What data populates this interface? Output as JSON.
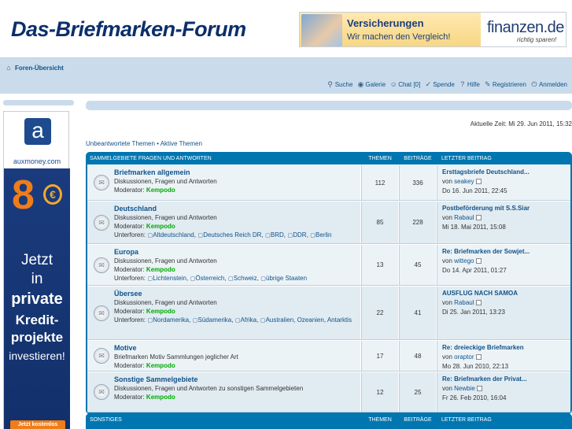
{
  "site": {
    "title": "Das-Briefmarken-Forum"
  },
  "banner": {
    "line1": "Versicherungen",
    "line2": "Wir machen den Vergleich!",
    "logo": "finanzen.de",
    "logo_sub": "richtig sparen!"
  },
  "nav": {
    "breadcrumb": "Foren-Übersicht",
    "links": [
      {
        "label": "Suche",
        "icon": "search-icon"
      },
      {
        "label": "Galerie",
        "icon": "eye-icon"
      },
      {
        "label": "Chat [0]",
        "icon": "users-icon"
      },
      {
        "label": "Spende",
        "icon": "check-icon"
      },
      {
        "label": "Hilfe",
        "icon": "question-icon"
      },
      {
        "label": "Registrieren",
        "icon": "pen-icon"
      },
      {
        "label": "Anmelden",
        "icon": "power-icon"
      }
    ]
  },
  "left_ad": {
    "brand": "auxmoney.com",
    "l1": "Jetzt",
    "l2": "in",
    "l3": "private",
    "l4": "Kredit-",
    "l5": "projekte",
    "l6": "investieren!",
    "button": "Jetzt kostenlos"
  },
  "main": {
    "current_time": "Aktuelle Zeit: Mi 29. Jun 2011, 15:32",
    "quicklinks": "Unbeantwortete Themen • Aktive Themen"
  },
  "categories": [
    {
      "name": "Sammelgebiete Fragen und Antworten",
      "col_topics": "Themen",
      "col_posts": "Beiträge",
      "col_last": "Letzter Beitrag",
      "forums": [
        {
          "title": "Briefmarken allgemein",
          "desc": "Diskussionen, Fragen und Antworten",
          "mod_label": "Moderator:",
          "moderator": "Kempodo",
          "subforums_label": "",
          "subforums": [],
          "topics": "112",
          "posts": "336",
          "last_title": "Ersttagsbriefe Deutschland...",
          "last_by_label": "von",
          "last_by": "seakey",
          "last_date": "Do 16. Jun 2011, 22:45"
        },
        {
          "title": "Deutschland",
          "desc": "Diskussionen, Fragen und Antworten",
          "mod_label": "Moderator:",
          "moderator": "Kempodo",
          "subforums_label": "Unterforen:",
          "subforums": [
            "Altdeutschland",
            "Deutsches Reich DR",
            "BRD",
            "DDR",
            "Berlin"
          ],
          "topics": "85",
          "posts": "228",
          "last_title": "Postbeförderung mit S.S.Siar",
          "last_by_label": "von",
          "last_by": "Rabaul",
          "last_date": "Mi 18. Mai 2011, 15:08"
        },
        {
          "title": "Europa",
          "desc": "Diskussionen, Fragen und Antworten",
          "mod_label": "Moderator:",
          "moderator": "Kempodo",
          "subforums_label": "Unterforen:",
          "subforums": [
            "Lichtenstein",
            "Österreich",
            "Schweiz",
            "übrige Staaten"
          ],
          "topics": "13",
          "posts": "45",
          "last_title": "Re: Briefmarken der Sowjet...",
          "last_by_label": "von",
          "last_by": "wittego",
          "last_date": "Do 14. Apr 2011, 01:27"
        },
        {
          "title": "Übersee",
          "desc": "Diskussionen, Fragen und Antworten",
          "mod_label": "Moderator:",
          "moderator": "Kempodo",
          "subforums_label": "Unterforen:",
          "subforums": [
            "Nordamerika",
            "Südamerika",
            "Afrika",
            "Australien, Ozeanien, Antarktis"
          ],
          "topics": "22",
          "posts": "41",
          "last_title": "AUSFLUG NACH SAMOA",
          "last_by_label": "von",
          "last_by": "Rabaul",
          "last_date": "Di 25. Jan 2011, 13:23"
        },
        {
          "title": "Motive",
          "desc": "Briefmarken Motiv Sammlungen jeglicher Art",
          "mod_label": "Moderator:",
          "moderator": "Kempodo",
          "subforums_label": "",
          "subforums": [],
          "topics": "17",
          "posts": "48",
          "last_title": "Re: dreieckige Briefmarken",
          "last_by_label": "von",
          "last_by": "oraptor",
          "last_date": "Mo 28. Jun 2010, 22:13"
        },
        {
          "title": "Sonstige Sammelgebiete",
          "desc": "Diskussionen, Fragen und Antworten zu sonstigen Sammelgebieten",
          "mod_label": "Moderator:",
          "moderator": "Kempodo",
          "subforums_label": "",
          "subforums": [],
          "topics": "12",
          "posts": "25",
          "last_title": "Re: Briefmarken der Privat...",
          "last_by_label": "von",
          "last_by": "Newbie",
          "last_date": "Fr 26. Feb 2010, 16:04"
        }
      ]
    },
    {
      "name": "Sonstiges",
      "col_topics": "Themen",
      "col_posts": "Beiträge",
      "col_last": "Letzter Beitrag",
      "forums": []
    }
  ],
  "colors": {
    "header_blue": "#0076b1",
    "nav_bg": "#cadceb",
    "moderator_green": "#00aa00",
    "link_blue": "#105289"
  }
}
